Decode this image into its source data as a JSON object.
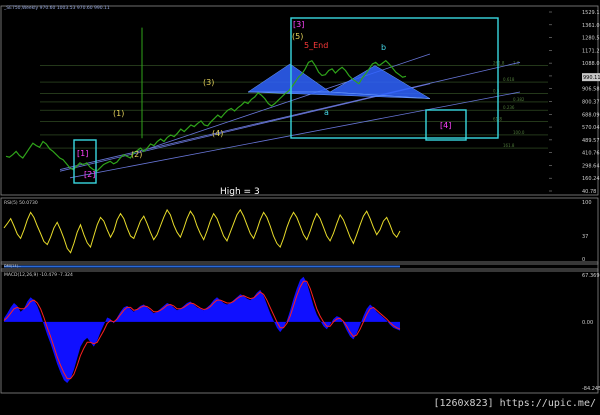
{
  "header": {
    "symbol_line": "_SE750,Weekly  970.60  1003.53  970.60  990.11",
    "pattern_label": "High = 3",
    "price_axis_badge": "990.11"
  },
  "watermark": "[1260x823] https://upic.me/",
  "colors": {
    "background": "#000000",
    "price_line": "#2fa41a",
    "ann_grey": "#d9d9d9",
    "ann_yellow": "#e4d15a",
    "ann_red": "#ff3a3a",
    "ann_magenta": "#ff44ff",
    "ann_cyan": "#44d6e6",
    "box_cyan": "#39d8e0",
    "harmonic_blue": "#2f63ff",
    "trendline": "#6876d8",
    "oscillator": "#e8dc2a",
    "macd_hist": "#1010ff",
    "macd_signal": "#ff2020",
    "panel_border": "#8a8a8a"
  },
  "price_panel": {
    "y_ticks": [
      "1529.1",
      "1361.0",
      "1280.5",
      "1171.2",
      "1088.0",
      "1010.2",
      "906.58",
      "800.37",
      "688.09",
      "570.04",
      "489.57",
      "410.76",
      "298.64",
      "160.24",
      "40.78"
    ],
    "wave_labels": [
      {
        "text": "[3]",
        "color": "ann_magenta"
      },
      {
        "text": "(5)",
        "color": "ann_yellow"
      },
      {
        "text": "5_End",
        "color": "ann_red"
      },
      {
        "text": "(3)",
        "color": "ann_yellow"
      },
      {
        "text": "(1)",
        "color": "ann_yellow"
      },
      {
        "text": "(2)",
        "color": "ann_yellow"
      },
      {
        "text": "(4)",
        "color": "ann_yellow"
      },
      {
        "text": "[1]",
        "color": "ann_magenta"
      },
      {
        "text": "[2]",
        "color": "ann_magenta"
      },
      {
        "text": "[4]",
        "color": "ann_magenta"
      },
      {
        "text": "b",
        "color": "ann_cyan"
      },
      {
        "text": "a",
        "color": "ann_cyan"
      }
    ],
    "fib_labels": [
      "1.0",
      "0.618",
      "0.5",
      "0.382",
      "0.236",
      "61.8",
      "100.0",
      "161.8",
      "261.8"
    ]
  },
  "rsi_panel": {
    "title": "RSI(5) 50.0730",
    "y_ticks": [
      "100",
      "37",
      "0"
    ]
  },
  "dmi_panel": {
    "title": "DMI(14)..."
  },
  "macd_panel": {
    "title": "MACD(12,26,9) -10.479 -7.324",
    "y_ticks": [
      "67.369",
      "0.00",
      "-84.245"
    ]
  },
  "chart_data": [
    {
      "type": "line",
      "title": "_SE750,Weekly",
      "series": [
        {
          "values": [
            510,
            505,
            520,
            540,
            515,
            500,
            530,
            560,
            590,
            575,
            565,
            600,
            585,
            555,
            540,
            520,
            500,
            490,
            465,
            440,
            430,
            450,
            470,
            460,
            470,
            445,
            430,
            420,
            440,
            460,
            470,
            480,
            465,
            475,
            500,
            520,
            510,
            500,
            530,
            545,
            560,
            540,
            560,
            585,
            575,
            600,
            615,
            600,
            625,
            640,
            630,
            650,
            675,
            660,
            680,
            700,
            690,
            710,
            725,
            700,
            695,
            720,
            740,
            760,
            745,
            770,
            790,
            800,
            785,
            805,
            820,
            840,
            830,
            855,
            870,
            895,
            880,
            860,
            830,
            815,
            830,
            850,
            870,
            890,
            905,
            930,
            960,
            990,
            1010,
            1040,
            1080,
            1090,
            1060,
            1020,
            1000,
            1005,
            1030,
            1040,
            1015,
            1035,
            1050,
            1030,
            1000,
            980,
            965,
            950,
            985,
            1010,
            1040,
            1070,
            1080,
            1060,
            1075,
            1090,
            1070,
            1045,
            1020,
            1005,
            990,
            995
          ]
        }
      ],
      "ylim": [
        40.78,
        1529.1
      ]
    },
    {
      "type": "line",
      "title": "RSI(5) 50.0730",
      "ylim": [
        0,
        100
      ],
      "series": [
        {
          "values": [
            55,
            62,
            70,
            58,
            45,
            38,
            52,
            68,
            80,
            72,
            58,
            46,
            33,
            28,
            40,
            55,
            64,
            52,
            38,
            22,
            15,
            30,
            48,
            60,
            44,
            31,
            24,
            42,
            60,
            72,
            66,
            52,
            40,
            50,
            68,
            78,
            70,
            55,
            42,
            38,
            52,
            66,
            74,
            62,
            48,
            36,
            44,
            58,
            72,
            84,
            76,
            60,
            48,
            40,
            54,
            70,
            82,
            74,
            58,
            46,
            36,
            50,
            66,
            78,
            70,
            56,
            42,
            34,
            48,
            62,
            76,
            84,
            74,
            60,
            46,
            38,
            52,
            68,
            80,
            72,
            58,
            42,
            30,
            24,
            38,
            56,
            70,
            80,
            72,
            58,
            44,
            36,
            50,
            66,
            78,
            70,
            56,
            42,
            34,
            46,
            62,
            76,
            68,
            54,
            40,
            30,
            44,
            60,
            74,
            82,
            70,
            56,
            44,
            52,
            66,
            72,
            60,
            46,
            40,
            50
          ]
        }
      ]
    },
    {
      "type": "area",
      "title": "MACD(12,26,9) -10.479 -7.324",
      "ylim": [
        -84.245,
        67.369
      ],
      "series": [
        {
          "name": "MACD",
          "values": [
            5,
            12,
            20,
            26,
            22,
            14,
            18,
            28,
            34,
            30,
            22,
            10,
            -4,
            -18,
            -30,
            -44,
            -58,
            -70,
            -80,
            -84,
            -78,
            -66,
            -50,
            -34,
            -26,
            -22,
            -28,
            -34,
            -26,
            -14,
            -4,
            6,
            4,
            -2,
            6,
            14,
            20,
            22,
            18,
            14,
            18,
            22,
            24,
            20,
            16,
            12,
            14,
            18,
            22,
            26,
            24,
            20,
            16,
            18,
            22,
            26,
            28,
            24,
            20,
            18,
            16,
            20,
            24,
            30,
            34,
            30,
            26,
            24,
            26,
            30,
            34,
            38,
            36,
            32,
            30,
            34,
            40,
            44,
            36,
            24,
            12,
            2,
            -8,
            -14,
            -8,
            2,
            16,
            32,
            46,
            58,
            62,
            54,
            38,
            22,
            10,
            2,
            -6,
            -10,
            -4,
            4,
            8,
            6,
            -2,
            -12,
            -20,
            -24,
            -16,
            -4,
            8,
            18,
            24,
            20,
            14,
            10,
            6,
            2,
            -4,
            -8,
            -10,
            -12
          ]
        },
        {
          "name": "Signal",
          "values": [
            2,
            6,
            12,
            18,
            20,
            18,
            18,
            22,
            28,
            30,
            26,
            18,
            6,
            -8,
            -20,
            -34,
            -48,
            -60,
            -70,
            -78,
            -78,
            -72,
            -60,
            -46,
            -36,
            -28,
            -28,
            -30,
            -28,
            -20,
            -12,
            -2,
            2,
            0,
            4,
            10,
            16,
            20,
            20,
            16,
            17,
            20,
            22,
            21,
            18,
            14,
            14,
            16,
            19,
            23,
            24,
            22,
            18,
            18,
            20,
            23,
            26,
            25,
            22,
            19,
            17,
            18,
            21,
            26,
            30,
            30,
            28,
            26,
            26,
            28,
            32,
            35,
            36,
            34,
            32,
            33,
            37,
            41,
            38,
            30,
            20,
            10,
            0,
            -8,
            -8,
            -2,
            8,
            22,
            36,
            48,
            56,
            56,
            46,
            32,
            18,
            8,
            0,
            -6,
            -6,
            0,
            4,
            5,
            1,
            -6,
            -14,
            -20,
            -18,
            -10,
            0,
            10,
            18,
            20,
            16,
            12,
            8,
            4,
            -1,
            -5,
            -8,
            -10
          ]
        }
      ]
    }
  ]
}
